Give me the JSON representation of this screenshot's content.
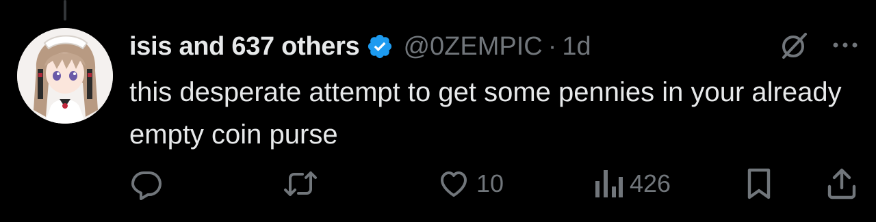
{
  "tweet": {
    "display_name": "isis and 637 others",
    "handle": "@0ZEMPIC",
    "separator": "·",
    "time": "1d",
    "text": "this desperate attempt to get some pennies in your already empty coin purse",
    "verified": true
  },
  "actions": {
    "replies": "",
    "reposts": "",
    "likes": "10",
    "views": "426"
  },
  "colors": {
    "background": "#000000",
    "text": "#e7e9ea",
    "secondary": "#71767b",
    "verified_blue": "#1d9bf0"
  },
  "icons": {
    "reply": "reply-icon",
    "repost": "repost-icon",
    "like": "heart-icon",
    "views": "views-icon",
    "bookmark": "bookmark-icon",
    "share": "share-icon",
    "grok": "grok-icon",
    "more": "more-icon",
    "verified": "verified-badge-icon"
  }
}
